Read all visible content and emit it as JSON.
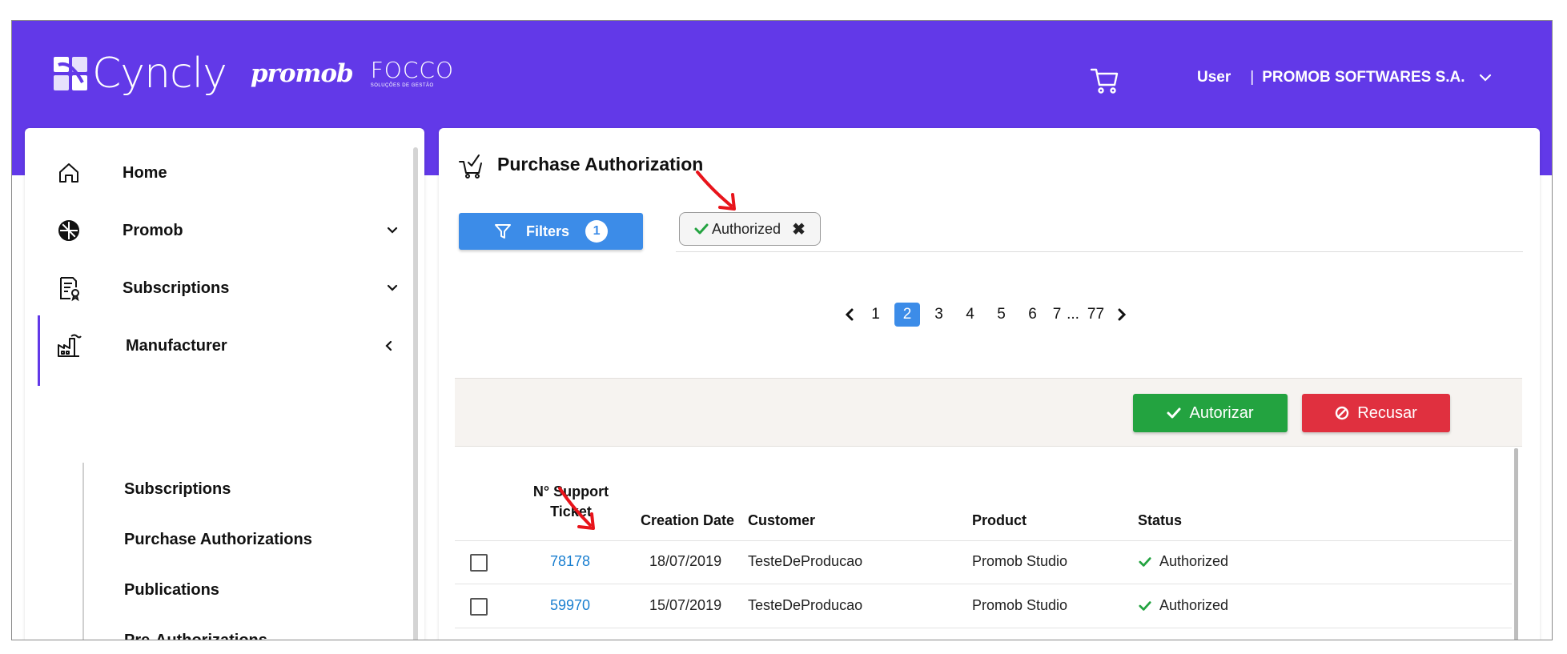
{
  "header": {
    "brand": "Cyncly",
    "brand2": "promob",
    "brand3": "FOCCO",
    "brand3_sub": "SOLUÇÕES DE GESTÃO",
    "user_label": "User",
    "separator": "|",
    "company": "PROMOB SOFTWARES S.A."
  },
  "sidebar": {
    "items": [
      {
        "label": "Home",
        "icon": "home-icon"
      },
      {
        "label": "Promob",
        "icon": "promob-icon"
      },
      {
        "label": "Subscriptions",
        "icon": "subscriptions-icon"
      },
      {
        "label": "Manufacturer",
        "icon": "factory-icon"
      }
    ],
    "sub_items": [
      {
        "label": "Subscriptions"
      },
      {
        "label": "Purchase Authorizations"
      },
      {
        "label": "Publications"
      },
      {
        "label": "Pre-Authorizations"
      }
    ]
  },
  "main": {
    "title": "Purchase Authorization",
    "filters_label": "Filters",
    "filters_count": "1",
    "chip_label": "Authorized",
    "chip_close": "✖",
    "pagination": {
      "pages": [
        "1",
        "2",
        "3",
        "4",
        "5",
        "6",
        "7"
      ],
      "current": "2",
      "ellipsis": "...",
      "last": "77"
    },
    "actions": {
      "authorize": "Autorizar",
      "refuse": "Recusar"
    },
    "table": {
      "headers": {
        "ticket_line1": "N° Support",
        "ticket_line2": "Ticket",
        "date": "Creation Date",
        "customer": "Customer",
        "product": "Product",
        "status": "Status"
      },
      "rows": [
        {
          "ticket": "78178",
          "date": "18/07/2019",
          "customer": "TesteDeProducao",
          "product": "Promob Studio",
          "status": "Authorized"
        },
        {
          "ticket": "59970",
          "date": "15/07/2019",
          "customer": "TesteDeProducao",
          "product": "Promob Studio",
          "status": "Authorized"
        }
      ]
    }
  },
  "colors": {
    "brand_purple": "#6239e8",
    "primary_blue": "#3c8ce8",
    "success_green": "#23a340",
    "danger_red": "#e0303f",
    "annotation_red": "#e8141b"
  }
}
